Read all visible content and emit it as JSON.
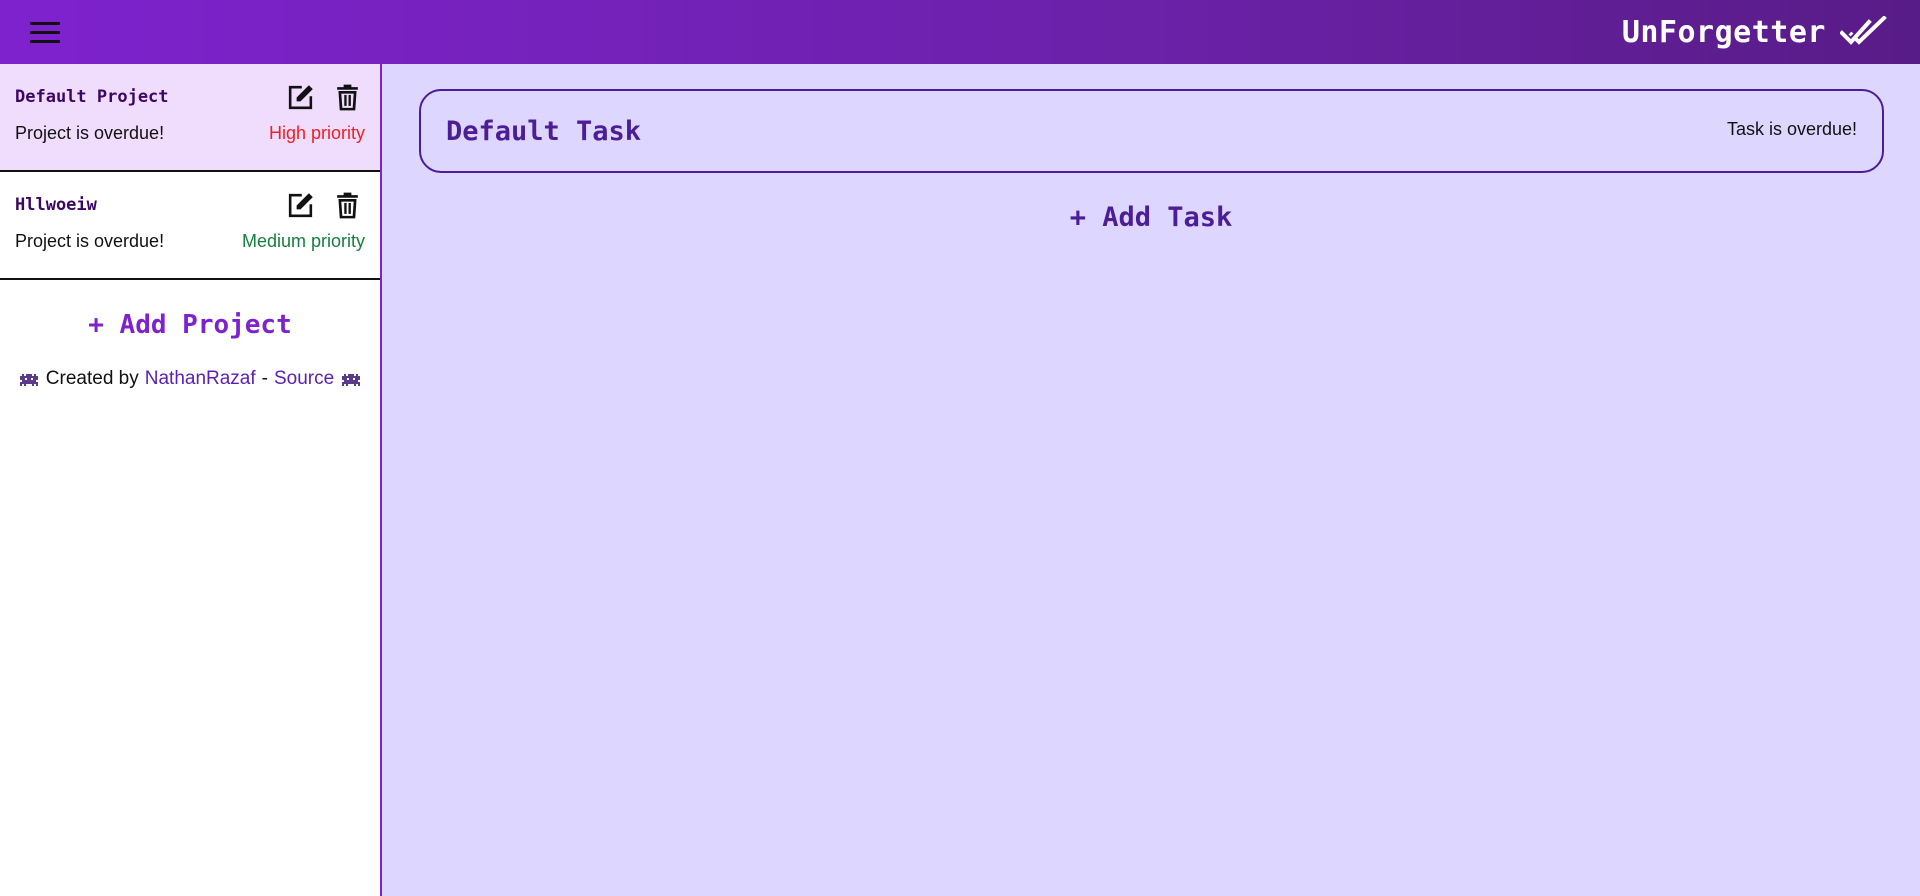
{
  "header": {
    "title": "UnForgetter",
    "menu_icon": "hamburger-menu-icon",
    "brand_icon": "double-check-icon",
    "gradient": [
      "#7e22ce",
      "#581c87"
    ]
  },
  "sidebar": {
    "projects": [
      {
        "name": "Default Project",
        "status": "Project is overdue!",
        "priority": "High priority",
        "priority_color": "#ef2020",
        "active": true
      },
      {
        "name": "Hllwoeiw",
        "status": "Project is overdue!",
        "priority": "Medium priority",
        "priority_color": "#15803d",
        "active": false
      }
    ],
    "add_project_label": "+ Add Project",
    "credits": {
      "prefix": "Created by",
      "author": "NathanRazaf",
      "separator": "-",
      "source": "Source"
    }
  },
  "main": {
    "tasks": [
      {
        "name": "Default Task",
        "status": "Task is overdue!"
      }
    ],
    "add_task_label": "+ Add Task"
  },
  "colors": {
    "accent": "#7e22ce",
    "main_bg": "#ddd6fe",
    "active_project_bg": "#f0dcfc",
    "text_dark_purple": "#4c1d95"
  }
}
